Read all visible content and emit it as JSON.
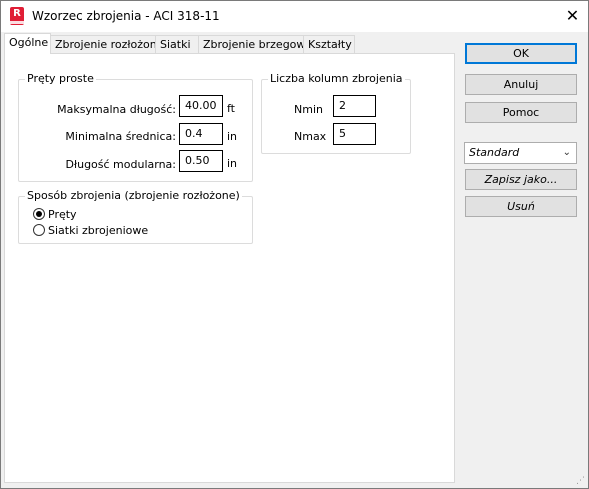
{
  "window": {
    "title": "Wzorzec zbrojenia - ACI 318-11",
    "app_icon_letter": "R",
    "close_glyph": "✕"
  },
  "tabs": [
    {
      "label": "Ogólne",
      "active": true
    },
    {
      "label": "Zbrojenie rozłożone",
      "active": false
    },
    {
      "label": "Siatki",
      "active": false
    },
    {
      "label": "Zbrojenie brzegowe",
      "active": false
    },
    {
      "label": "Kształty",
      "active": false
    }
  ],
  "straight_bars": {
    "legend": "Pręty proste",
    "max_length": {
      "label": "Maksymalna długość:",
      "value": "40.00",
      "unit": "ft"
    },
    "min_diameter": {
      "label": "Minimalna średnica:",
      "value": "0.4",
      "unit": "in"
    },
    "modular_length": {
      "label": "Długość modularna:",
      "value": "0.50",
      "unit": "in"
    }
  },
  "columns": {
    "legend": "Liczba kolumn zbrojenia",
    "nmin": {
      "label": "Nmin",
      "value": "2"
    },
    "nmax": {
      "label": "Nmax",
      "value": "5"
    }
  },
  "method": {
    "legend": "Sposób zbrojenia (zbrojenie rozłożone)",
    "options": [
      {
        "label": "Pręty",
        "selected": true
      },
      {
        "label": "Siatki zbrojeniowe",
        "selected": false
      }
    ]
  },
  "buttons": {
    "ok": "OK",
    "cancel": "Anuluj",
    "help": "Pomoc",
    "save_as": "Zapisz jako...",
    "delete": "Usuń"
  },
  "preset_select": {
    "value": "Standard",
    "chevron": "⌄"
  },
  "colors": {
    "accent": "#0078d7",
    "app_icon": "#e01e36"
  }
}
